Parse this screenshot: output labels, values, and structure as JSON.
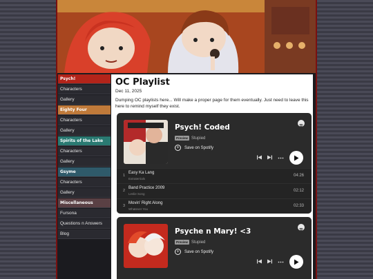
{
  "nav": {
    "items": [
      {
        "label": "Psych!",
        "type": "head",
        "color": "#b3241a"
      },
      {
        "label": "Characters",
        "type": "link"
      },
      {
        "label": "Gallery",
        "type": "link"
      },
      {
        "label": "Eighty Four",
        "type": "head",
        "color": "#c07a3a"
      },
      {
        "label": "Characters",
        "type": "link"
      },
      {
        "label": "Gallery",
        "type": "link"
      },
      {
        "label": "Spirits of the Lake",
        "type": "head",
        "color": "#2a7a72"
      },
      {
        "label": "Characters",
        "type": "link"
      },
      {
        "label": "Gallery",
        "type": "link"
      },
      {
        "label": "Gsyme",
        "type": "head",
        "color": "#2f5a6a"
      },
      {
        "label": "Characters",
        "type": "link"
      },
      {
        "label": "Gallery",
        "type": "link"
      },
      {
        "label": "Miscellaneous",
        "type": "head",
        "color": "#5a4044"
      },
      {
        "label": "Fursona",
        "type": "link"
      },
      {
        "label": "Questions n Answers",
        "type": "link"
      },
      {
        "label": "Blog",
        "type": "link"
      }
    ]
  },
  "post": {
    "title": "OC Playlist",
    "date": "Dec 11, 2025",
    "body": "Dumping OC playlists here... Will make a proper page for them eventually. Just need to leave this here to remind myself they exist."
  },
  "embeds": [
    {
      "title": "Psych! Coded",
      "badge": "Preview",
      "owner": "Stupied",
      "save_label": "Save on Spotify",
      "tracks": [
        {
          "num": "1",
          "name": "Easy Ka Lang",
          "artist": "Extraterrials",
          "duration": "04:26"
        },
        {
          "num": "2",
          "name": "Band Practice 2009",
          "artist": "Leslie Song",
          "duration": "02:12"
        },
        {
          "num": "3",
          "name": "Movin' Right Along",
          "artist": "Whatever You",
          "duration": "02:33"
        }
      ]
    },
    {
      "title": "Psyche n Mary! <3",
      "badge": "Preview",
      "owner": "Stupied",
      "save_label": "Save on Spotify",
      "tracks": []
    }
  ],
  "colors": {
    "frame_border": "#7a1010",
    "content_bg": "#ffffff",
    "embed_bg": "#2b2b2b"
  }
}
